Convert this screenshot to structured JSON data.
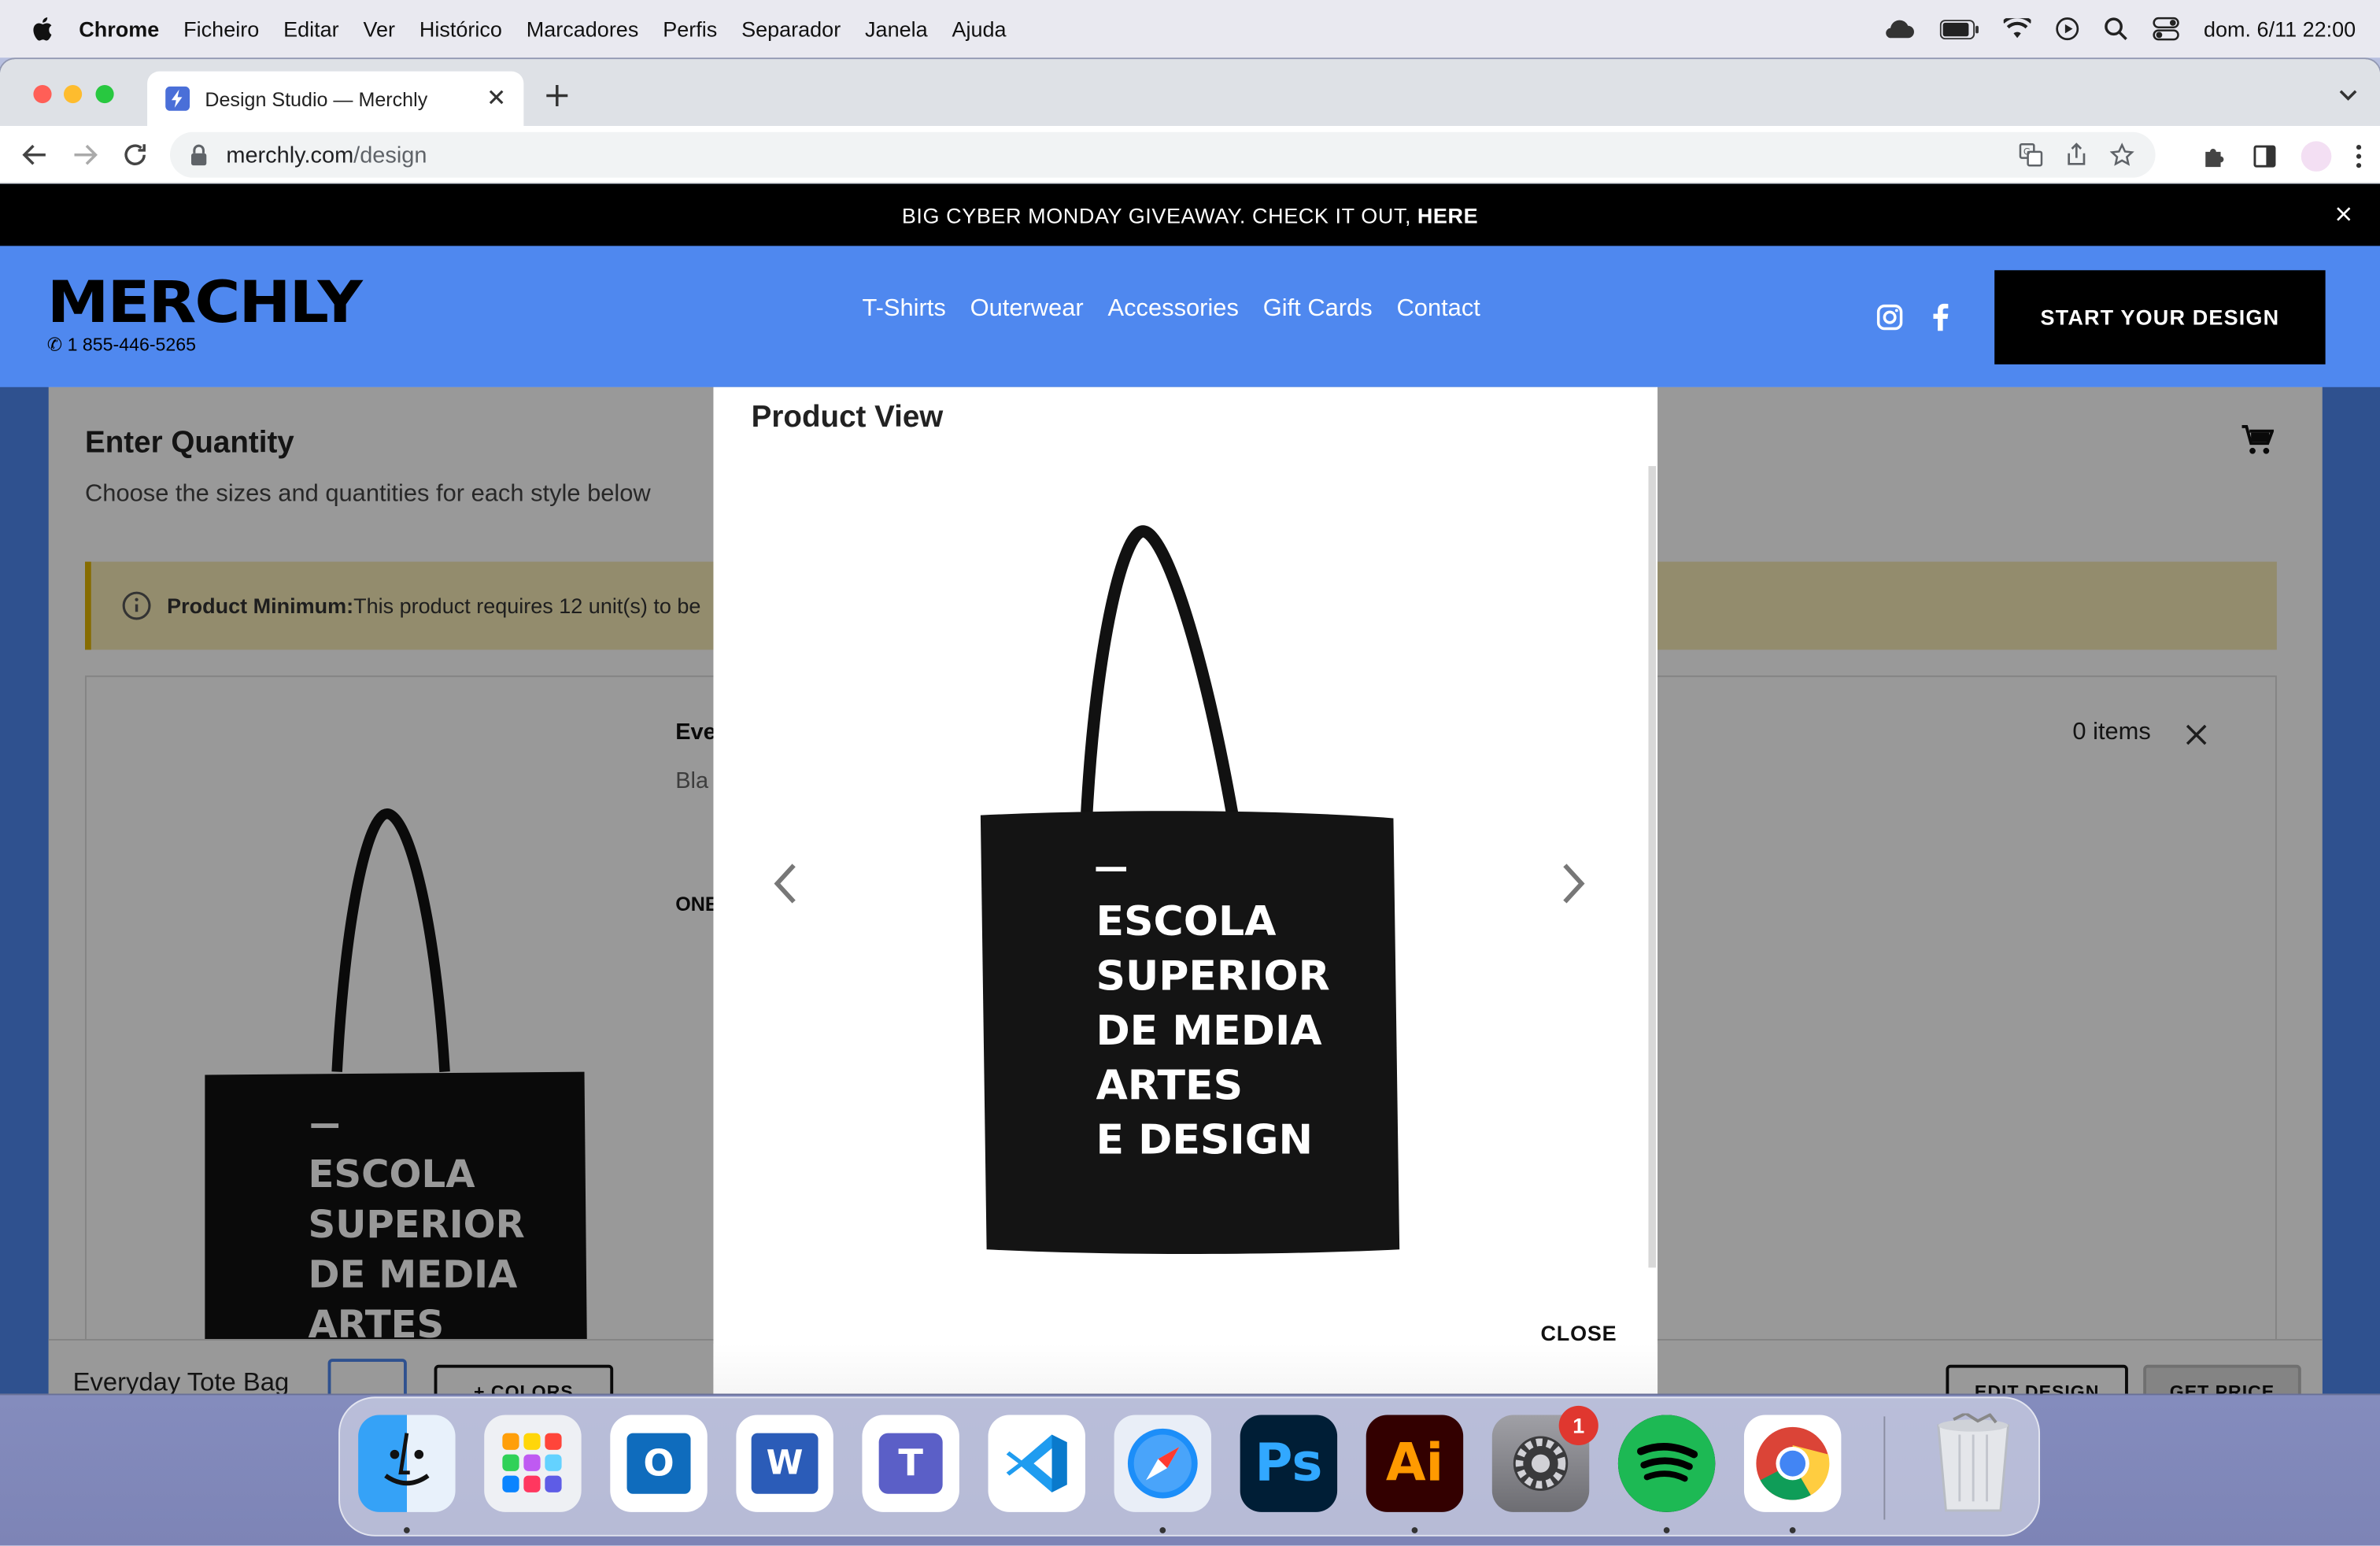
{
  "menubar": {
    "app_name": "Chrome",
    "menus": [
      "Ficheiro",
      "Editar",
      "Ver",
      "Histórico",
      "Marcadores",
      "Perfis",
      "Separador",
      "Janela",
      "Ajuda"
    ],
    "datetime": "dom. 6/11  22:00"
  },
  "browser": {
    "tab_title": "Design Studio — Merchly",
    "url_host": "merchly.com",
    "url_path": "/design"
  },
  "promo": {
    "text": "BIG CYBER MONDAY GIVEAWAY. CHECK IT OUT,",
    "link": "HERE"
  },
  "header": {
    "logo": "MERCHLY",
    "phone": "✆ 1 855-446-5265",
    "nav": [
      "T-Shirts",
      "Outerwear",
      "Accessories",
      "Gift Cards",
      "Contact"
    ],
    "cta": "START YOUR DESIGN"
  },
  "quantity": {
    "title": "Enter Quantity",
    "subtitle": "Choose the sizes and quantities for each style below",
    "notice_label": "Product Minimum:",
    "notice_text": "This product requires 12 unit(s) to be",
    "product_name_partial": "Eve",
    "product_color_partial": "Bla",
    "size_partial": "ONE",
    "items_count": "0 items"
  },
  "bottom_bar": {
    "product_name": "Everyday Tote Bag",
    "colors_btn": "+ COLORS",
    "edit_btn": "EDIT DESIGN",
    "price_btn": "GET PRICE"
  },
  "modal": {
    "title": "Product View",
    "close": "CLOSE"
  },
  "bag_print": {
    "lines": [
      "ESCOLA",
      "SUPERIOR",
      "DE MEDIA",
      "ARTES",
      "E DESIGN"
    ]
  },
  "dock": {
    "apps": [
      {
        "name": "Finder",
        "icon": "finder-icon",
        "bg": "#2b8cf5",
        "glyph": "☺"
      },
      {
        "name": "Launchpad",
        "icon": "launchpad-icon",
        "bg": "#eef0f4",
        "glyph": ""
      },
      {
        "name": "Outlook",
        "icon": "outlook-icon",
        "bg": "#0f6cbd",
        "glyph": "O"
      },
      {
        "name": "Word",
        "icon": "word-icon",
        "bg": "#2b5cb8",
        "glyph": "W"
      },
      {
        "name": "Teams",
        "icon": "teams-icon",
        "bg": "#5b5fc7",
        "glyph": "T"
      },
      {
        "name": "Visual Studio Code",
        "icon": "vscode-icon",
        "bg": "#ffffff",
        "glyph": "❮❯"
      },
      {
        "name": "Safari",
        "icon": "safari-icon",
        "bg": "#e9eef7",
        "glyph": "✦"
      },
      {
        "name": "Photoshop",
        "icon": "photoshop-icon",
        "bg": "#001e36",
        "glyph": "Ps"
      },
      {
        "name": "Illustrator",
        "icon": "illustrator-icon",
        "bg": "#330000",
        "glyph": "Ai"
      },
      {
        "name": "System Preferences",
        "icon": "settings-icon",
        "bg": "#8e8e93",
        "glyph": "⚙",
        "badge": "1"
      },
      {
        "name": "Spotify",
        "icon": "spotify-icon",
        "bg": "#1db954",
        "glyph": ""
      },
      {
        "name": "Chrome",
        "icon": "chrome-icon",
        "bg": "#ffffff",
        "glyph": ""
      },
      {
        "name": "Trash",
        "icon": "trash-icon",
        "bg": "transparent",
        "glyph": ""
      }
    ]
  }
}
